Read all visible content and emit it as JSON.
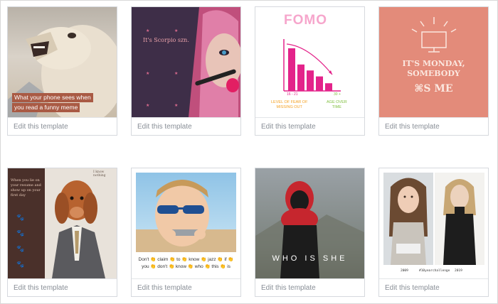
{
  "templates": [
    {
      "edit_label": "Edit this template",
      "icon": "photo-thumbnail",
      "overlay_text": [
        "What your phone sees when",
        "you read a funny meme"
      ],
      "overlay_bg": "#a95a44"
    },
    {
      "edit_label": "Edit this template",
      "icon": "photo-thumbnail",
      "overlay_text": "It's Scorpio szn.",
      "bg": "#3e2e48",
      "accent": "#e8a0a8"
    },
    {
      "edit_label": "Edit this template",
      "icon": "chart-thumbnail",
      "title": "FOMO",
      "label_left": "16 - 21",
      "label_right": "30 +",
      "caption_left": [
        "LEVEL OF FEAR OF",
        "MISSING OUT"
      ],
      "caption_right": [
        "AGE OVER",
        "TIME"
      ],
      "chart_data": {
        "type": "bar",
        "values": [
          100,
          62,
          48,
          34,
          18
        ],
        "color": "#e3238a"
      }
    },
    {
      "edit_label": "Edit this template",
      "icon": "monitor-thumbnail",
      "bg": "#e38b7a",
      "line1": "IT'S MONDAY,",
      "line2": "SOMEBODY",
      "line3": "⌘S ME"
    },
    {
      "edit_label": "Edit this template",
      "icon": "photo-thumbnail",
      "side_text": [
        "When you lie on",
        "your resume and",
        "show up on your",
        "first day"
      ],
      "top_text": "I know nothing",
      "bg": "#4a302a"
    },
    {
      "edit_label": "Edit this template",
      "icon": "photo-thumbnail",
      "caption_lines": [
        "Don't 👏 claim 👏 to 👏 know 👏 jazz 👏 if 👏",
        "you 👏 don't 👏 know 👏 who 👏 this 👏 is"
      ]
    },
    {
      "edit_label": "Edit this template",
      "icon": "photo-thumbnail",
      "overlay_text": "WHO IS SHE"
    },
    {
      "edit_label": "Edit this template",
      "icon": "photo-thumbnail",
      "year_left": "2009",
      "hashtag": "#10yearchallenge",
      "year_right": "2019"
    }
  ]
}
